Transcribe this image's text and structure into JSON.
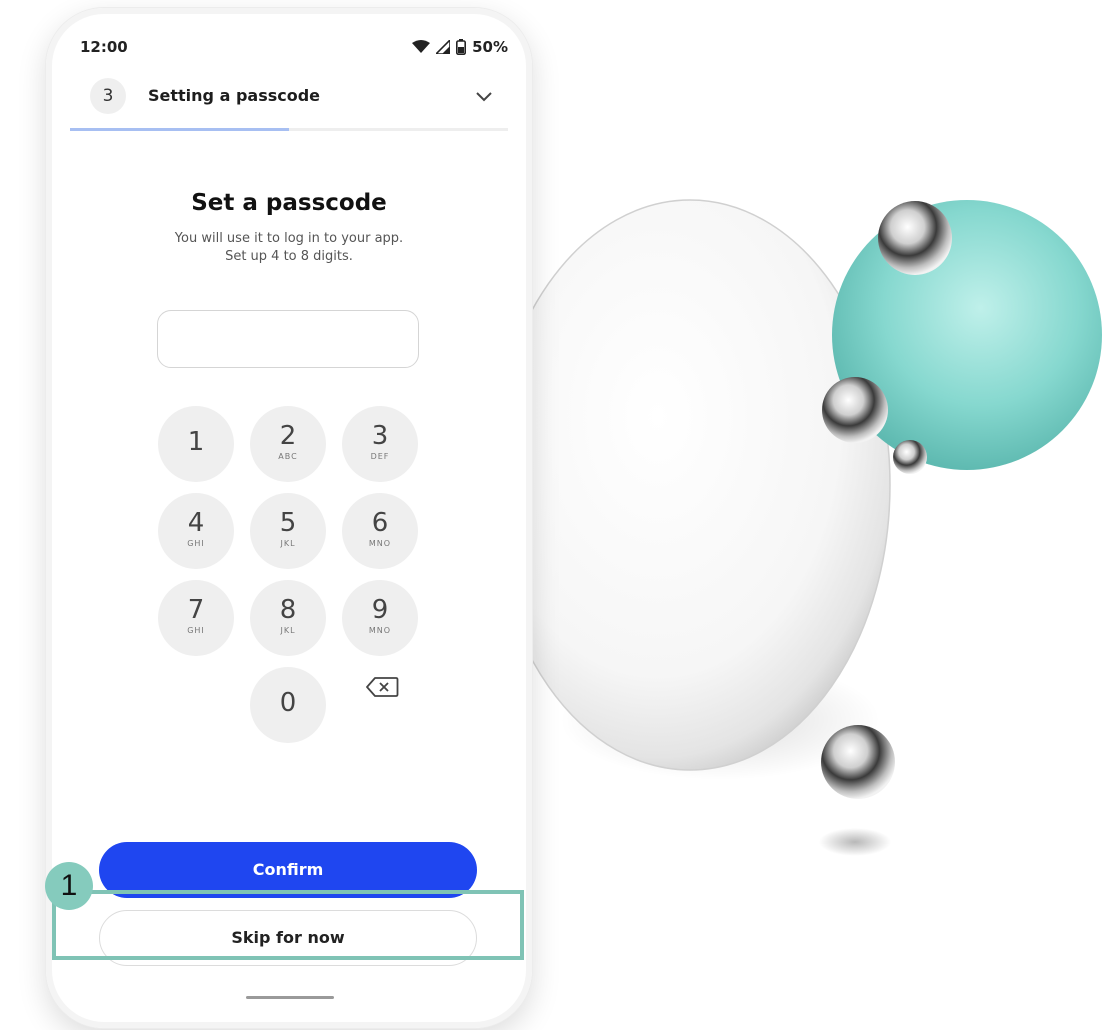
{
  "status_bar": {
    "time": "12:00",
    "battery": "50%"
  },
  "step": {
    "number": "3",
    "title": "Setting a passcode",
    "progress": 0.5
  },
  "main": {
    "heading": "Set a passcode",
    "description_line1": "You will use it to log in to your app.",
    "description_line2": "Set up 4 to 8 digits.",
    "passcode_value": ""
  },
  "keypad": [
    {
      "digit": "1",
      "letters": ""
    },
    {
      "digit": "2",
      "letters": "ABC"
    },
    {
      "digit": "3",
      "letters": "DEF"
    },
    {
      "digit": "4",
      "letters": "GHI"
    },
    {
      "digit": "5",
      "letters": "JKL"
    },
    {
      "digit": "6",
      "letters": "MNO"
    },
    {
      "digit": "7",
      "letters": "GHI"
    },
    {
      "digit": "8",
      "letters": "JKL"
    },
    {
      "digit": "9",
      "letters": "MNO"
    },
    {
      "digit": "0",
      "letters": ""
    }
  ],
  "actions": {
    "confirm_label": "Confirm",
    "skip_label": "Skip for now"
  },
  "callout": {
    "number": "1"
  },
  "colors": {
    "primary": "#1f46f0",
    "progress": "#a7bff2",
    "callout": "#7fc3b5",
    "sphere_teal": "#7fd6cf"
  },
  "icons": {
    "status": [
      "wifi-icon",
      "signal-icon",
      "battery-icon"
    ],
    "step": "chevron-down-icon",
    "keypad": "backspace-icon"
  }
}
